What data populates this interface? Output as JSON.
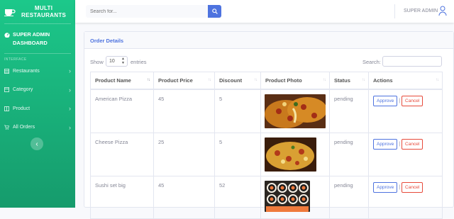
{
  "sidebar": {
    "brand_line1": "MULTI",
    "brand_line2": "RESTAURANTS",
    "dashboard_line1": "SUPER ADMIN",
    "dashboard_line2": "DASHBOARD",
    "heading": "INTERFACE",
    "items": [
      {
        "label": "Restaurants",
        "icon": "table-icon"
      },
      {
        "label": "Category",
        "icon": "folder-icon"
      },
      {
        "label": "Product",
        "icon": "box-icon"
      },
      {
        "label": "All Orders",
        "icon": "cart-icon"
      }
    ],
    "toggle": "‹"
  },
  "topbar": {
    "search_placeholder": "Search for...",
    "user_name": "SUPER ADMIN"
  },
  "card": {
    "title": "Order Details",
    "show_label": "Show",
    "length_value": "10",
    "entries_label": "entries",
    "search_label": "Search:"
  },
  "table": {
    "headers": [
      "Product Name",
      "Product Price",
      "Discount",
      "Product Photo",
      "Status",
      "Actions"
    ],
    "rows": [
      {
        "name": "American Pizza",
        "price": "45",
        "discount": "5",
        "status": "pending",
        "approve": "Approve",
        "cancel": "Cancel"
      },
      {
        "name": "Cheese Pizza",
        "price": "25",
        "discount": "5",
        "status": "pending",
        "approve": "Approve",
        "cancel": "Cancel"
      },
      {
        "name": "Sushi set big",
        "price": "45",
        "discount": "52",
        "status": "pending",
        "approve": "Approve",
        "cancel": "Cancel"
      }
    ],
    "separator": "|"
  },
  "colors": {
    "sidebar_top": "#1cc88a",
    "sidebar_bottom": "#169b6c",
    "primary": "#4e73df",
    "danger": "#e74a3b"
  }
}
